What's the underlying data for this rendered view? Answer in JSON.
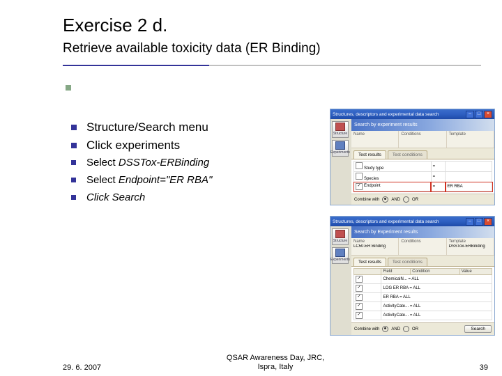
{
  "title": "Exercise 2 d.",
  "subtitle": "Retrieve available toxicity data (ER Binding)",
  "bullets1": {
    "b1": "Structure/Search menu",
    "b2": "Click experiments"
  },
  "bullets2": {
    "b1_pre": "Select ",
    "b1_em": "DSSTox-ERBinding",
    "b2_pre": "Select ",
    "b2_em": "Endpoint=\"ER RBA\"",
    "b3_em": "Click Search"
  },
  "footer": {
    "date": "29. 6. 2007",
    "center_l1": "QSAR Awareness Day, JRC,",
    "center_l2": "Ispra, Italy",
    "page": "39"
  },
  "shot1": {
    "wintitle": "Structures, descriptors and experimental data search",
    "banner": "Search by experiment results",
    "sidebar": {
      "s1": "Structure",
      "s2": "Experiments"
    },
    "cols": {
      "c1": "Name",
      "c2": "Conditions",
      "c3": "Template"
    },
    "tabs": {
      "t1": "Test results",
      "t2": "Test conditions"
    },
    "rows": {
      "r1": "Study type",
      "r2": "Species",
      "r3": "Endpoint",
      "op": "=",
      "val": "ER RBA"
    },
    "foot": {
      "label": "Combine with",
      "r1": "AND",
      "r2": "OR"
    }
  },
  "shot2": {
    "wintitle": "Structures, descriptors and experimental data search",
    "banner": "Search by Experiment results",
    "sidebar": {
      "s1": "Structure",
      "s2": "Experiments"
    },
    "cols": {
      "c1": "Name",
      "c2": "Conditions",
      "c3": "Template"
    },
    "val1": "LC50.ER Binding",
    "val3": "DSSTox-ERBinding",
    "tabs": {
      "t1": "Test results",
      "t2": "Test conditions"
    },
    "th": {
      "h1": "Field",
      "h2": "Condition",
      "h3": "Value"
    },
    "rows": {
      "r1": "ChemicalN... = ALL",
      "r2": "LOG ER RBA = ALL",
      "r3": "ER RBA = ALL",
      "r4": "ActivityCate... = ALL",
      "r5": "ActivityCate... = ALL"
    },
    "foot": {
      "label": "Combine with",
      "r1": "AND",
      "r2": "OR",
      "btn": "Search"
    }
  }
}
